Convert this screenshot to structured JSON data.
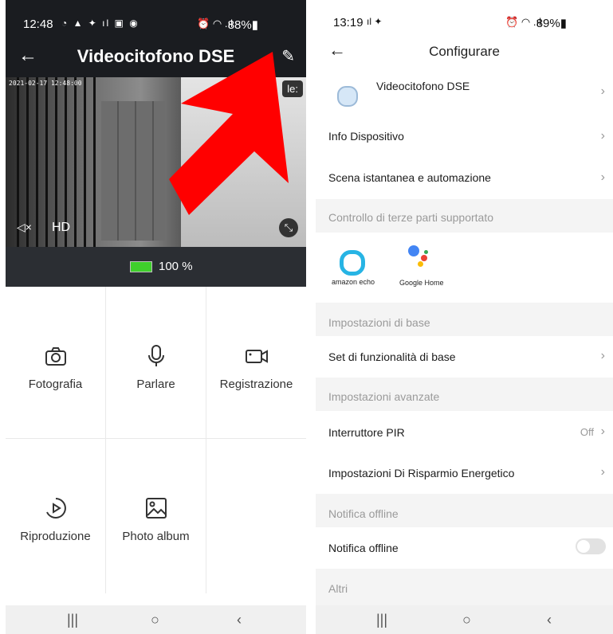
{
  "left": {
    "status": {
      "time": "12:48",
      "icons": "◔ ▲ ✦ ıl ▣ ◉",
      "right_icons": "⏰ ◠ .ıl",
      "battery": "88%▮"
    },
    "header": {
      "title": "Videocitofono DSE"
    },
    "video": {
      "timestamp": "2021-02-17 12:48:00",
      "overlay_label": "le:",
      "quality": "HD"
    },
    "battery": {
      "text": "100 %",
      "level": 1.0
    },
    "actions": [
      {
        "label": "Fotografia",
        "icon": "camera-icon"
      },
      {
        "label": "Parlare",
        "icon": "microphone-icon"
      },
      {
        "label": "Registrazione",
        "icon": "video-camera-icon"
      },
      {
        "label": "Riproduzione",
        "icon": "playback-icon"
      },
      {
        "label": "Photo album",
        "icon": "image-icon"
      }
    ]
  },
  "right": {
    "status": {
      "time": "13:19",
      "icons": "ıl ✦",
      "right_icons": "⏰ ◠ .ıl",
      "battery": "89%▮"
    },
    "header": {
      "title": "Configurare"
    },
    "device": {
      "name": "Videocitofono DSE"
    },
    "rows": {
      "info": "Info Dispositivo",
      "scene": "Scena istantanea e automazione",
      "third_party_section": "Controllo di terze parti supportato",
      "base_section": "Impostazioni di base",
      "base_set": "Set di funzionalità di base",
      "advanced_section": "Impostazioni avanzate",
      "pir": "Interruttore PIR",
      "pir_value": "Off",
      "energy": "Impostazioni Di Risparmio Energetico",
      "offline_section": "Notifica offline",
      "offline": "Notifica offline",
      "others_section": "Altri"
    },
    "integrations": {
      "alexa": "amazon echo",
      "google": "Google Home"
    },
    "offline_toggle": false
  }
}
